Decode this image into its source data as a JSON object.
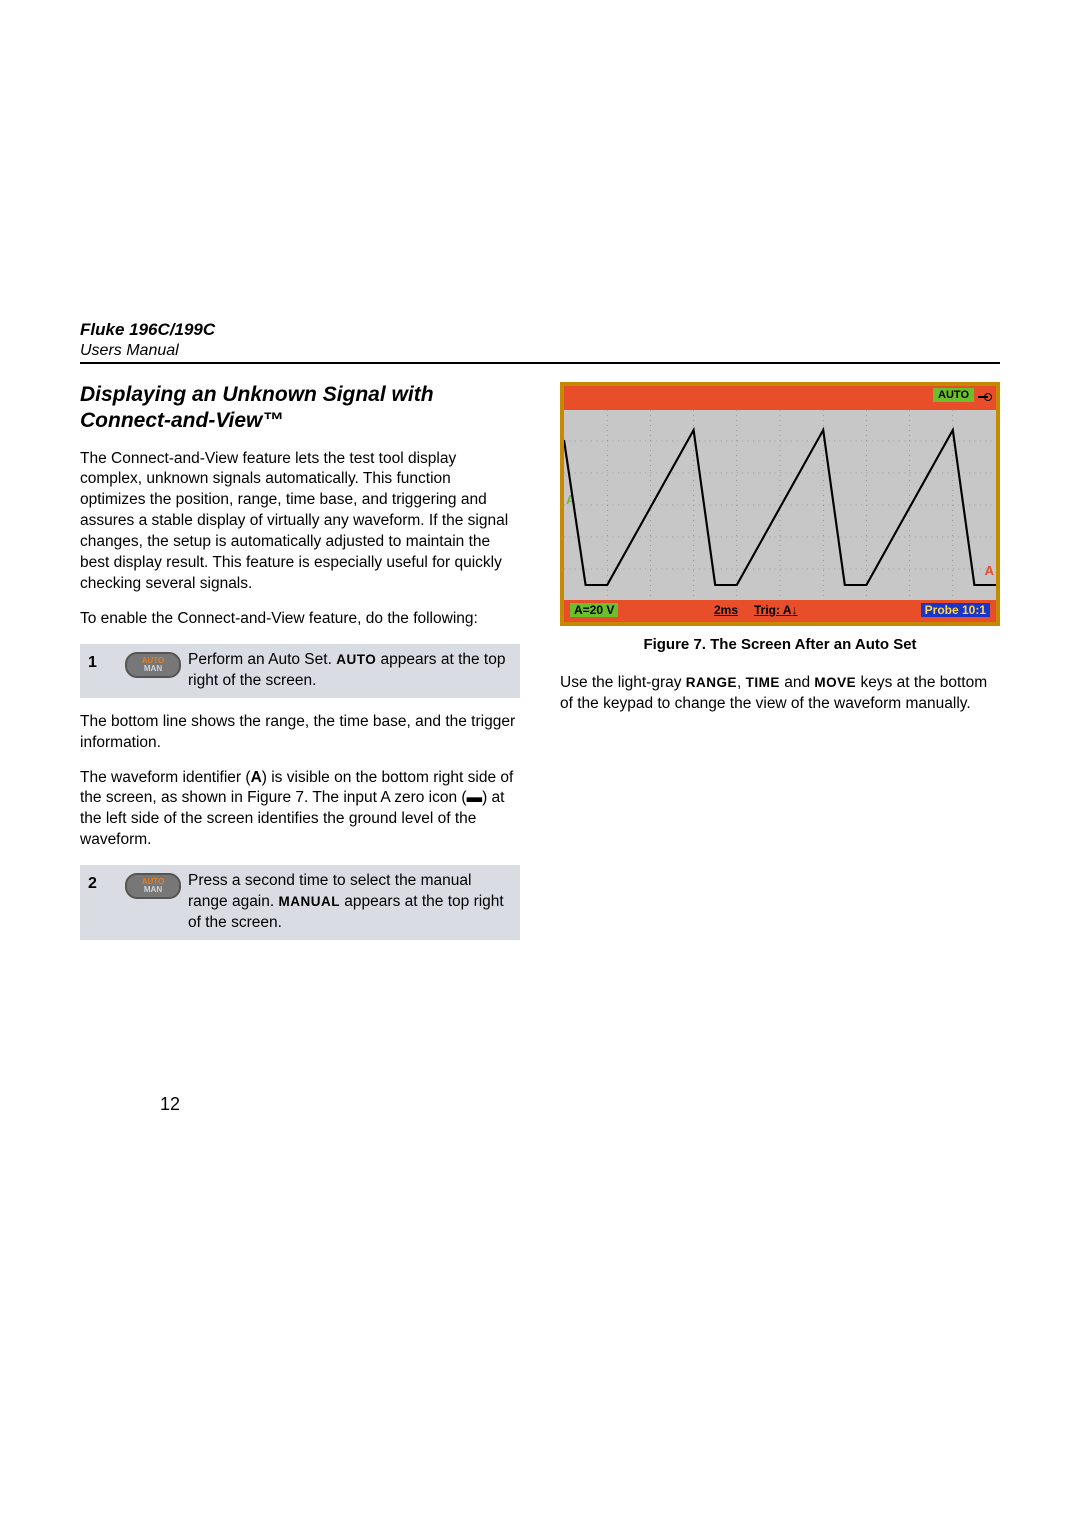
{
  "header": {
    "model": "Fluke 196C/199C",
    "manual": "Users Manual"
  },
  "left": {
    "section_title": "Displaying an Unknown Signal with Connect-and-View™",
    "intro": "The Connect-and-View feature lets the test tool display complex, unknown signals automatically. This function optimizes the position, range, time base, and triggering and assures a stable display of virtually any waveform. If the signal changes, the setup is automatically adjusted to maintain the best display result. This feature is especially useful for quickly checking several signals.",
    "enable_line": "To enable the Connect-and-View feature, do the following:",
    "step1_num": "1",
    "btn_top": "AUTO",
    "btn_bot": "MAN",
    "step1_pre": "Perform an Auto Set. ",
    "step1_sc": "AUTO",
    "step1_post": " appears at the top right of the screen.",
    "bottom_line": "The bottom line shows the range, the time base, and the trigger information.",
    "wave_pre": "The waveform identifier (",
    "wave_bold": "A",
    "wave_mid": ") is visible on the bottom right side of the screen, as shown in Figure 7. The input A zero icon (",
    "wave_icon": "▬",
    "wave_post": ") at the left side of the screen identifies the ground level of the waveform.",
    "step2_num": "2",
    "step2_pre": "Press a second time to select the manual range again. ",
    "step2_sc": "MANUAL",
    "step2_post": " appears at the top right of the screen."
  },
  "right": {
    "scope": {
      "auto_badge": "AUTO",
      "a_left": "A",
      "a_right": "A",
      "bottom_left": "A=20 V",
      "bottom_time": "2ms",
      "bottom_trig": "Trig: A↓",
      "bottom_right": "Probe 10:1"
    },
    "figcap": "Figure 7. The Screen After an Auto Set",
    "keys_pre": "Use the light-gray ",
    "k1": "RANGE",
    "sep1": ", ",
    "k2": "TIME",
    "sep2": " and ",
    "k3": "MOVE",
    "keys_post": " keys at the bottom of the keypad to change the view of the waveform manually."
  },
  "pagenum": "12"
}
